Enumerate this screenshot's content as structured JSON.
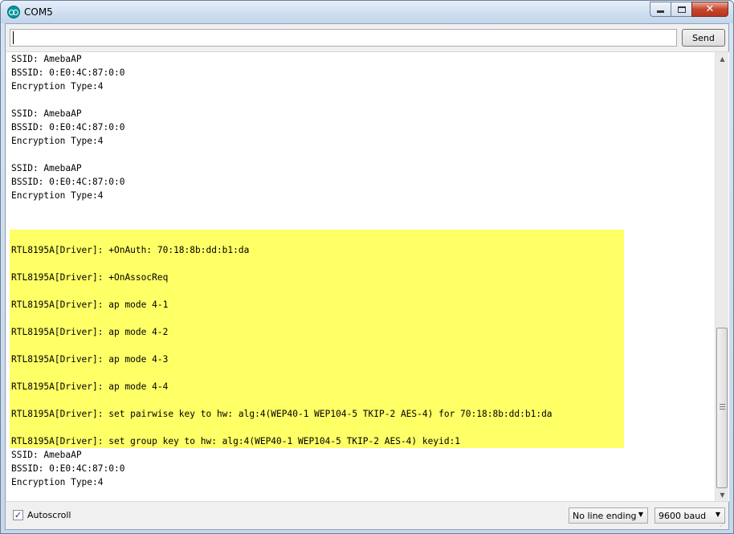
{
  "window": {
    "title": "COM5",
    "minimize_icon": "minimize-icon",
    "maximize_icon": "maximize-icon",
    "close_label": "✕"
  },
  "input": {
    "value": "",
    "send_label": "Send"
  },
  "output": {
    "highlight_color": "#ffff66",
    "lines": [
      {
        "text": "SSID: AmebaAP",
        "hl": false
      },
      {
        "text": "BSSID: 0:E0:4C:87:0:0",
        "hl": false
      },
      {
        "text": "Encryption Type:4",
        "hl": false
      },
      {
        "text": "",
        "hl": false
      },
      {
        "text": "SSID: AmebaAP",
        "hl": false
      },
      {
        "text": "BSSID: 0:E0:4C:87:0:0",
        "hl": false
      },
      {
        "text": "Encryption Type:4",
        "hl": false
      },
      {
        "text": "",
        "hl": false
      },
      {
        "text": "SSID: AmebaAP",
        "hl": false
      },
      {
        "text": "BSSID: 0:E0:4C:87:0:0",
        "hl": false
      },
      {
        "text": "Encryption Type:4",
        "hl": false
      },
      {
        "text": "",
        "hl": false
      },
      {
        "text": "",
        "hl": false
      },
      {
        "text": "",
        "hl": true
      },
      {
        "text": "RTL8195A[Driver]: +OnAuth: 70:18:8b:dd:b1:da",
        "hl": true
      },
      {
        "text": "",
        "hl": true
      },
      {
        "text": "RTL8195A[Driver]: +OnAssocReq",
        "hl": true
      },
      {
        "text": "",
        "hl": true
      },
      {
        "text": "RTL8195A[Driver]: ap mode 4-1",
        "hl": true
      },
      {
        "text": "",
        "hl": true
      },
      {
        "text": "RTL8195A[Driver]: ap mode 4-2",
        "hl": true
      },
      {
        "text": "",
        "hl": true
      },
      {
        "text": "RTL8195A[Driver]: ap mode 4-3",
        "hl": true
      },
      {
        "text": "",
        "hl": true
      },
      {
        "text": "RTL8195A[Driver]: ap mode 4-4",
        "hl": true
      },
      {
        "text": "",
        "hl": true
      },
      {
        "text": "RTL8195A[Driver]: set pairwise key to hw: alg:4(WEP40-1 WEP104-5 TKIP-2 AES-4) for 70:18:8b:dd:b1:da",
        "hl": true
      },
      {
        "text": "",
        "hl": true
      },
      {
        "text": "RTL8195A[Driver]: set group key to hw: alg:4(WEP40-1 WEP104-5 TKIP-2 AES-4) keyid:1",
        "hl": true
      },
      {
        "text": "SSID: AmebaAP",
        "hl": false
      },
      {
        "text": "BSSID: 0:E0:4C:87:0:0",
        "hl": false
      },
      {
        "text": "Encryption Type:4",
        "hl": false
      }
    ]
  },
  "footer": {
    "autoscroll_label": "Autoscroll",
    "autoscroll_checked": true,
    "line_ending": "No line ending",
    "baud": "9600 baud"
  }
}
